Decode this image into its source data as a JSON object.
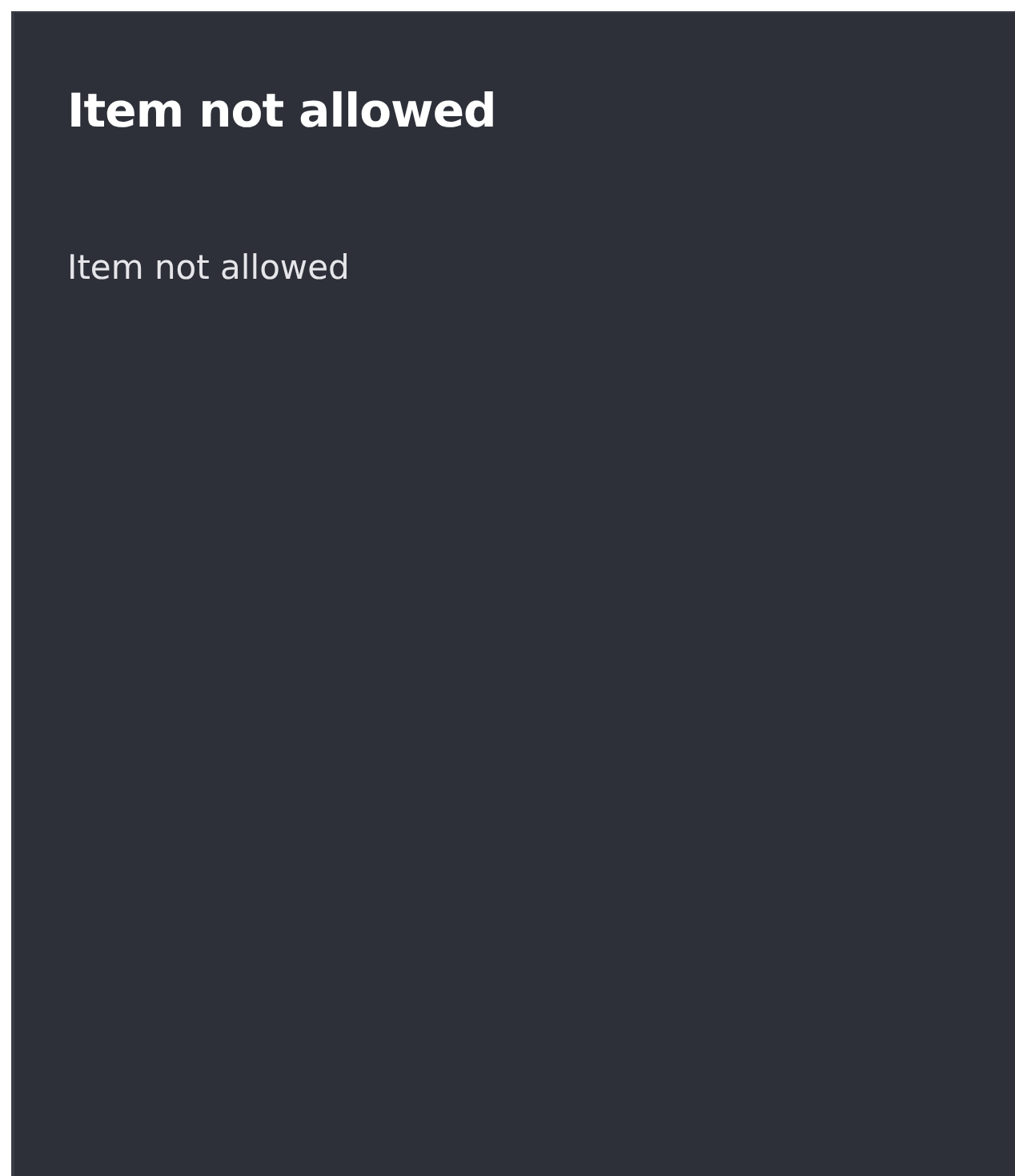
{
  "dialog": {
    "title": "Item not allowed",
    "message": "Item not allowed"
  }
}
